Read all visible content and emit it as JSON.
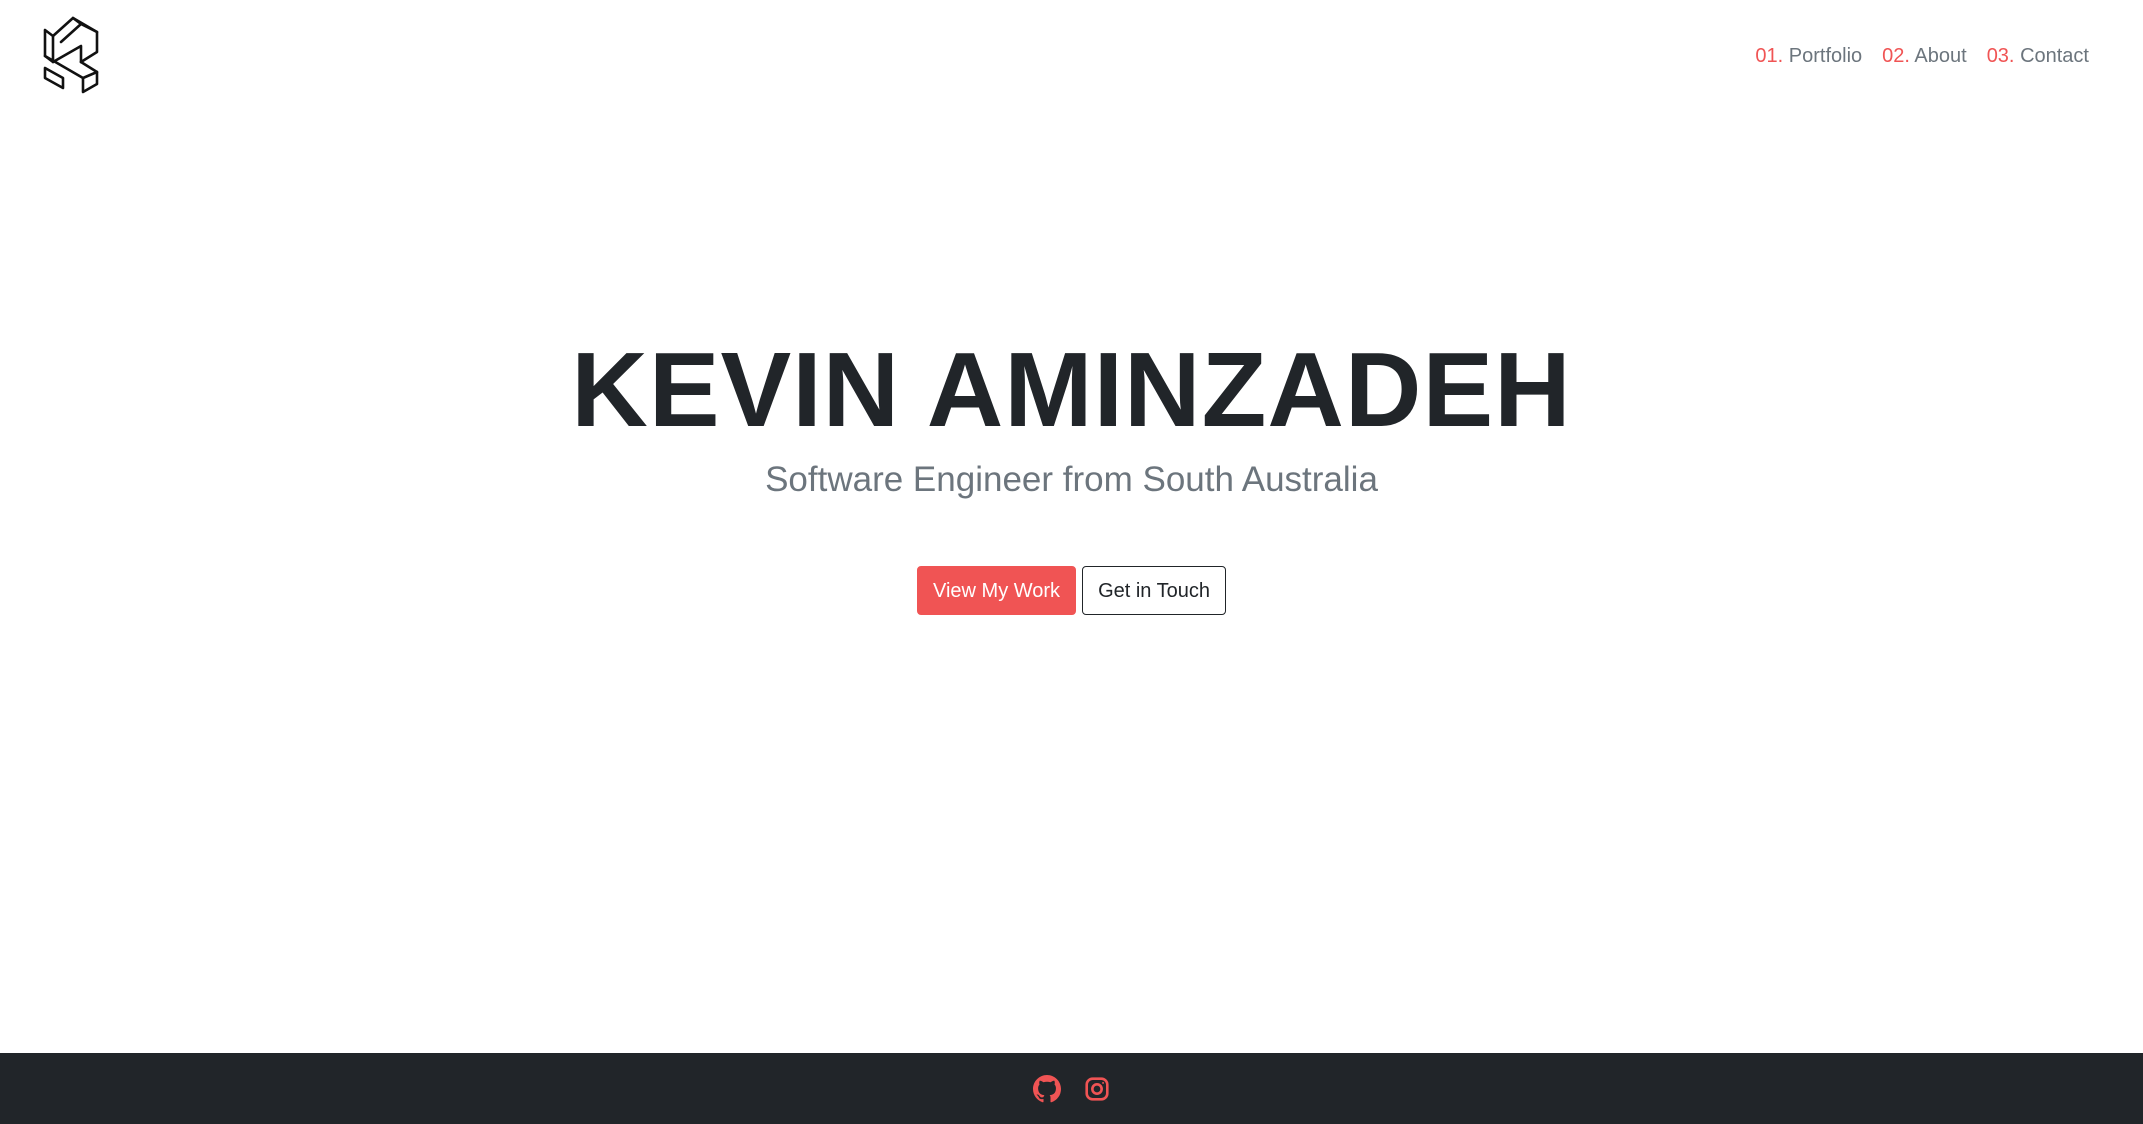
{
  "header": {
    "logo_icon": "k-monogram-logo-icon",
    "nav": [
      {
        "number": "01.",
        "label": "Portfolio"
      },
      {
        "number": "02.",
        "label": "About"
      },
      {
        "number": "03.",
        "label": "Contact"
      }
    ]
  },
  "hero": {
    "title": "KEVIN AMINZADEH",
    "subtitle": "Software Engineer from South Australia",
    "primary_button": "View My Work",
    "secondary_button": "Get in Touch"
  },
  "footer": {
    "icons": [
      "github-icon",
      "instagram-icon"
    ]
  },
  "colors": {
    "accent": "#f05454",
    "text_dark": "#212529",
    "text_muted": "#6c757d",
    "footer_bg": "#212529"
  }
}
